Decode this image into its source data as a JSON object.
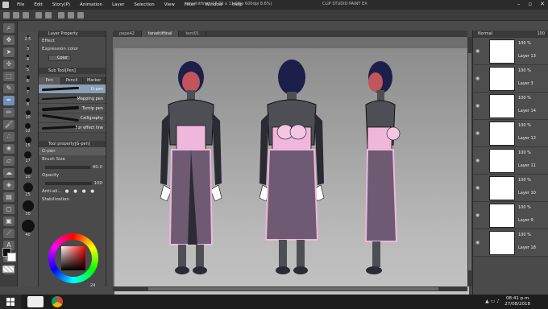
{
  "title_bar": {
    "menus": [
      "File",
      "Edit",
      "Story(P)",
      "Animation",
      "Layer",
      "Selection",
      "View",
      "Filter",
      "Window",
      "Help"
    ],
    "doc_title": "tenwhitfinal (17.00 x 11.00in 600dpi 8.6%)",
    "app_name": "CLIP STUDIO PAINT EX"
  },
  "doc_tabs": [
    "pepe42",
    "tenwhitfinal",
    "tent01"
  ],
  "tool_property": {
    "header": "Layer Property",
    "effect_label": "Effect",
    "expression_label": "Expression color",
    "expression_value": "Color"
  },
  "sub_tool": {
    "header": "Sub Tool[Pen]",
    "tabs": [
      "Pen",
      "Pencil",
      "Marker"
    ],
    "brushes": [
      "G-pen",
      "Mapping pen",
      "Turnip pen",
      "Calligraphy",
      "For effect line"
    ]
  },
  "brush_props": {
    "header": "Tool property[G-pen]",
    "current": "G-pen",
    "brush_size_label": "Brush Size",
    "brush_size": "40.0",
    "opacity_label": "Opacity",
    "opacity": "100",
    "anti_alias_label": "Anti-ali...",
    "stabilization_label": "Stabilization"
  },
  "size_presets": [
    "2.5",
    "3",
    "4",
    "5",
    "6",
    "7",
    "8",
    "10",
    "12",
    "15",
    "17",
    "20",
    "25",
    "30",
    "40"
  ],
  "color_wheel_value": "24",
  "layer_panel": {
    "blend_mode": "Normal",
    "opacity": "100",
    "layers": [
      {
        "name": "Layer 13",
        "opacity": "100 %",
        "selected": false
      },
      {
        "name": "Layer 3",
        "opacity": "100 %",
        "selected": false
      },
      {
        "name": "Layer 14",
        "opacity": "100 %",
        "selected": false
      },
      {
        "name": "Layer 12",
        "opacity": "100 %",
        "selected": false
      },
      {
        "name": "Layer 11",
        "opacity": "100 %",
        "selected": false
      },
      {
        "name": "Layer 10",
        "opacity": "100 %",
        "selected": false
      },
      {
        "name": "Layer 9",
        "opacity": "100 %",
        "selected": false
      },
      {
        "name": "Layer 18",
        "opacity": "100 %",
        "selected": false
      }
    ]
  },
  "taskbar": {
    "time": "08:41 p.m.",
    "date": "27/08/2018"
  },
  "colors": {
    "accent": "#6f8fb8",
    "skirt": "#6e5a72",
    "obi": "#f0b7dc",
    "body": "#4e4f55",
    "face": "#c0555a"
  }
}
